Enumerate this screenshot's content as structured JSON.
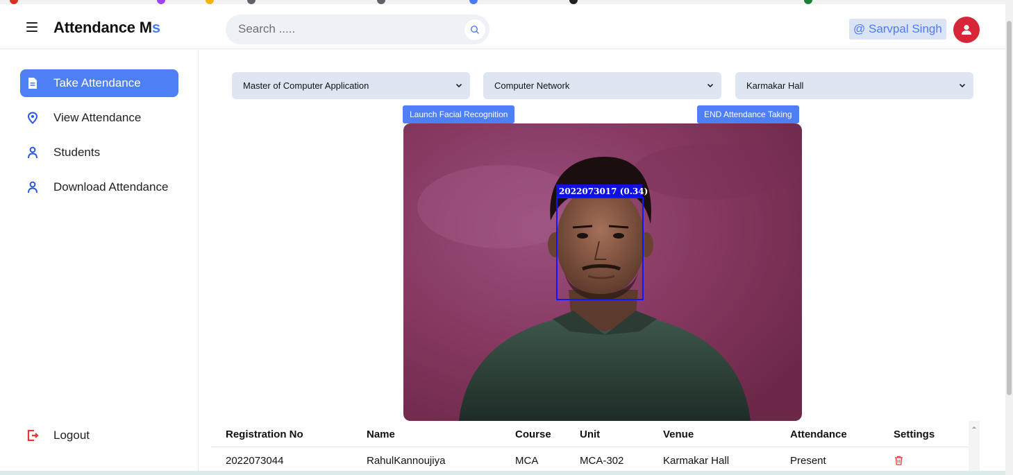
{
  "header": {
    "title_main": "Attendance M",
    "title_accent": "s",
    "search_placeholder": "Search .....",
    "user_tag": "@ Sarvpal Singh"
  },
  "sidebar": {
    "items": [
      {
        "label": "Take Attendance",
        "icon": "document-icon",
        "active": true
      },
      {
        "label": "View Attendance",
        "icon": "location-pin-icon",
        "active": false
      },
      {
        "label": "Students",
        "icon": "person-icon",
        "active": false
      },
      {
        "label": "Download Attendance",
        "icon": "person-icon",
        "active": false
      }
    ],
    "logout_label": "Logout"
  },
  "filters": {
    "course": "Master of Computer Application",
    "subject": "Computer Network",
    "venue": "Karmakar Hall"
  },
  "actions": {
    "launch": "Launch Facial Recognition",
    "end": "END Attendance Taking"
  },
  "camera": {
    "detection_label": "2022073017 (0.34)"
  },
  "table": {
    "headers": [
      "Registration No",
      "Name",
      "Course",
      "Unit",
      "Venue",
      "Attendance",
      "Settings"
    ],
    "rows": [
      [
        "2022073044",
        "RahulKannoujiya",
        "MCA",
        "MCA-302",
        "Karmakar Hall",
        "Present"
      ]
    ]
  },
  "colors": {
    "accent": "#4f7ff5",
    "avatar": "#d72638",
    "logout": "#e53935",
    "delete": "#e53935"
  }
}
